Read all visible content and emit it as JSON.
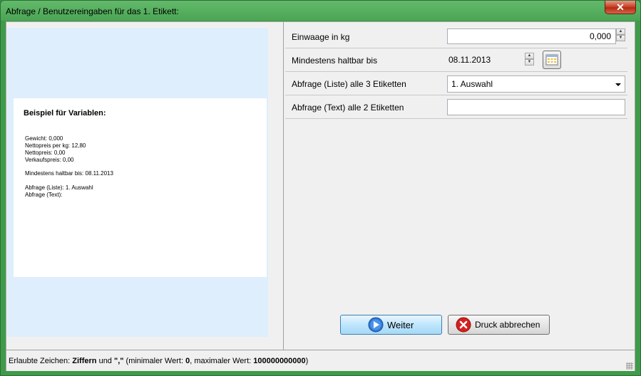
{
  "window": {
    "title": "Abfrage / Benutzereingaben für das 1. Etikett:",
    "close_glyph": "✕"
  },
  "preview": {
    "heading": "Beispiel für Variablen:",
    "lines": [
      "Gewicht: 0,000",
      "Nettopreis per kg: 12,80",
      "Nettopreis: 0,00",
      "Verkaufspreis: 0,00",
      "Mindestens haltbar bis: 08.11.2013",
      "Abfrage (Liste): 1. Auswahl",
      "Abfrage (Text):"
    ]
  },
  "form": {
    "weight": {
      "label": "Einwaage in kg",
      "value": "0,000"
    },
    "best_before": {
      "label": "Mindestens haltbar bis",
      "value": "08.11.2013"
    },
    "list_query": {
      "label": "Abfrage (Liste) alle 3 Etiketten",
      "value": "1. Auswahl"
    },
    "text_query": {
      "label": "Abfrage (Text) alle 2 Etiketten",
      "value": ""
    }
  },
  "buttons": {
    "next": "Weiter",
    "cancel": "Druck abbrechen"
  },
  "status": {
    "prefix": "Erlaubte Zeichen: ",
    "allowed": "Ziffern",
    "und": " und ",
    "comma": "\",\"",
    "min_label": " (minimaler Wert: ",
    "min_value": "0",
    "max_label": ", maximaler Wert: ",
    "max_value": "100000000000",
    "suffix": ")"
  },
  "colors": {
    "title_bar": "#4aa553",
    "preview_bg": "#deeefc",
    "close": "#c9452a"
  }
}
